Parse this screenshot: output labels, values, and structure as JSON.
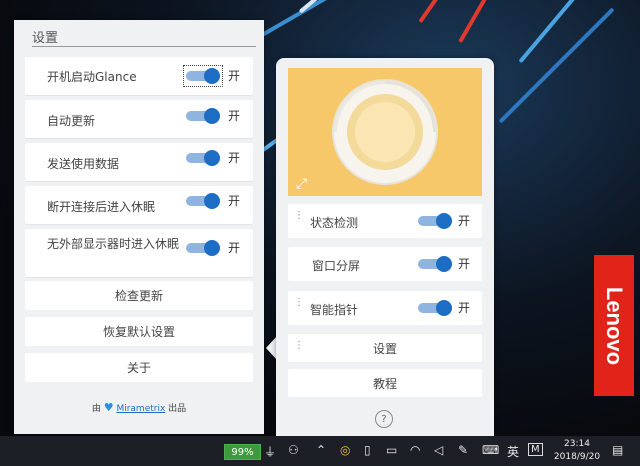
{
  "settings": {
    "title": "设置",
    "toggles": [
      {
        "label": "开机启动Glance",
        "state": "开"
      },
      {
        "label": "自动更新",
        "state": "开"
      },
      {
        "label": "发送使用数据",
        "state": "开"
      },
      {
        "label": "断开连接后进入休眠",
        "state": "开"
      },
      {
        "label": "无外部显示器时进入休眠",
        "state": "开"
      }
    ],
    "buttons": {
      "check_update": "检查更新",
      "restore_defaults": "恢复默认设置",
      "about": "关于"
    },
    "footer": {
      "prefix": "由",
      "brand": "Mirametrix",
      "suffix": "出品"
    }
  },
  "glance": {
    "items": [
      {
        "label": "状态检测",
        "state": "开"
      },
      {
        "label": "窗口分屏",
        "state": "开"
      },
      {
        "label": "智能指针",
        "state": "开"
      }
    ],
    "settings_button": "设置",
    "tutorial_button": "教程",
    "help": "?",
    "preview_color": "#f6c86a"
  },
  "desktop": {
    "brand": "Lenovo",
    "brand_color": "#e2231a"
  },
  "taskbar": {
    "battery": "99%",
    "ime": "英",
    "time": "23:14",
    "date": "2018/9/20"
  },
  "accent_color": "#1e6dc4"
}
